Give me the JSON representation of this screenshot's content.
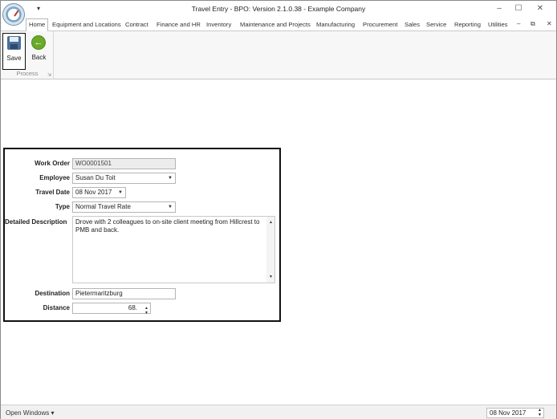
{
  "window": {
    "title": "Travel Entry - BPO: Version 2.1.0.38 - Example Company"
  },
  "tabs": [
    {
      "label": "Home"
    },
    {
      "label": "Equipment and Locations"
    },
    {
      "label": "Contract"
    },
    {
      "label": "Finance and HR"
    },
    {
      "label": "Inventory"
    },
    {
      "label": "Maintenance and Projects"
    },
    {
      "label": "Manufacturing"
    },
    {
      "label": "Procurement"
    },
    {
      "label": "Sales"
    },
    {
      "label": "Service"
    },
    {
      "label": "Reporting"
    },
    {
      "label": "Utilities"
    }
  ],
  "ribbon": {
    "save_label": "Save",
    "back_label": "Back",
    "group_label": "Process"
  },
  "form": {
    "work_order": {
      "label": "Work Order",
      "value": "WO0001501"
    },
    "employee": {
      "label": "Employee",
      "value": "Susan Du Toit"
    },
    "travel_date": {
      "label": "Travel Date",
      "value": "08 Nov 2017"
    },
    "type": {
      "label": "Type",
      "value": "Normal Travel Rate"
    },
    "description": {
      "label": "Detailed Description",
      "value": "Drove with 2 colleagues to on-site client meeting from Hillcrest to PMB and back."
    },
    "destination": {
      "label": "Destination",
      "value": "Pietermaritzburg"
    },
    "distance": {
      "label": "Distance",
      "value": "68."
    }
  },
  "statusbar": {
    "open_windows": "Open Windows",
    "date": "08 Nov 2017"
  },
  "icons": {
    "app_logo": "gauge-icon",
    "save": "floppy-disk-icon",
    "back": "back-arrow-icon"
  }
}
